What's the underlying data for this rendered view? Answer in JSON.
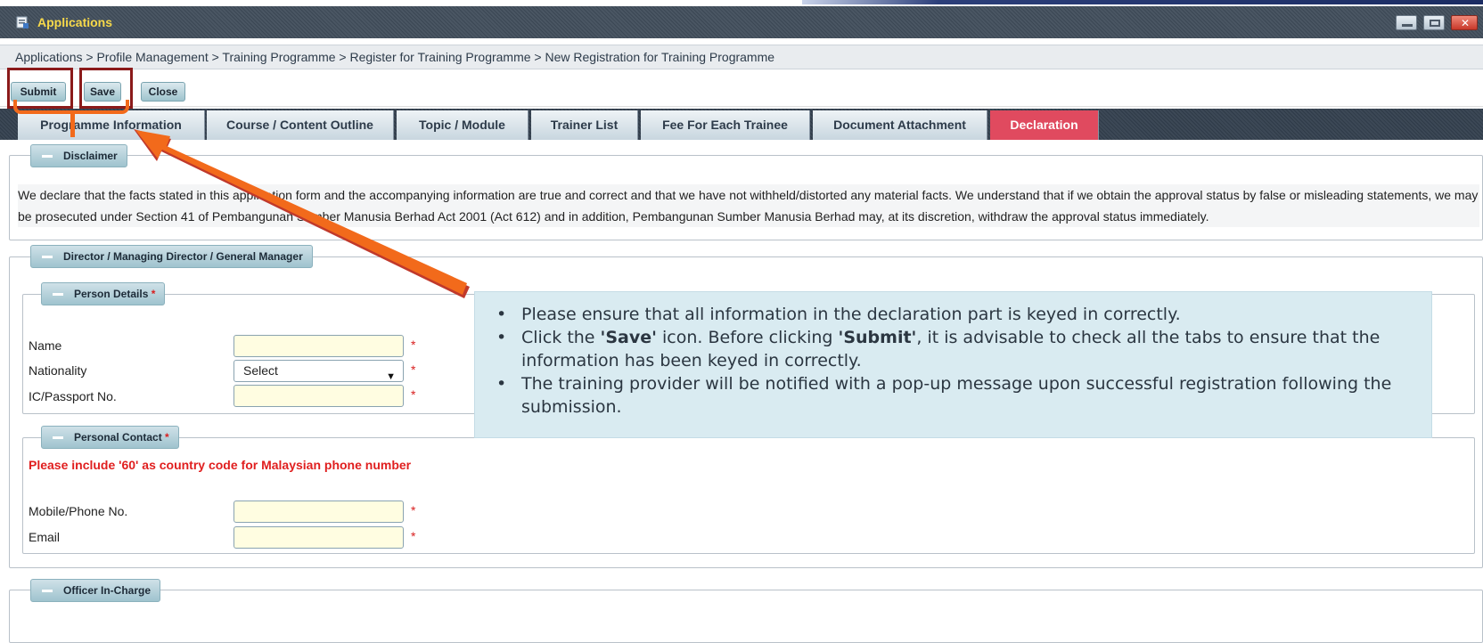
{
  "window": {
    "title": "Applications"
  },
  "breadcrumb": "Applications  >  Profile Management  >  Training Programme  >  Register for Training Programme  >  New Registration for Training Programme",
  "toolbar": {
    "submit": "Submit",
    "save": "Save",
    "close": "Close"
  },
  "tabs": [
    {
      "label": "Programme Information"
    },
    {
      "label": "Course / Content Outline"
    },
    {
      "label": "Topic / Module"
    },
    {
      "label": "Trainer List"
    },
    {
      "label": "Fee For Each Trainee"
    },
    {
      "label": "Document Attachment"
    },
    {
      "label": "Declaration",
      "active": true
    }
  ],
  "disclaimer": {
    "legend": "Disclaimer",
    "text": "We declare that the facts stated in this application form and the accompanying information are true and correct and that we have not withheld/distorted any material facts. We understand that if we obtain the approval status by false or misleading statements, we may be prosecuted under Section 41 of Pembangunan Sumber Manusia Berhad Act 2001 (Act 612) and in addition, Pembangunan Sumber Manusia Berhad may, at its discretion, withdraw the approval status immediately."
  },
  "director": {
    "legend": "Director / Managing Director / General Manager",
    "person_details": {
      "legend": "Person Details",
      "name_label": "Name",
      "name_value": "",
      "nationality_label": "Nationality",
      "nationality_value": "Select",
      "ic_label": "IC/Passport No.",
      "ic_value": ""
    },
    "personal_contact": {
      "legend": "Personal Contact",
      "note": "Please include '60' as country code for Malaysian phone number",
      "mobile_label": "Mobile/Phone No.",
      "mobile_value": "",
      "email_label": "Email",
      "email_value": ""
    }
  },
  "officer": {
    "legend": "Officer In-Charge"
  },
  "callout": {
    "items": [
      "Please ensure that all information in the declaration part is keyed in correctly.",
      "Click the 'Save' icon. Before clicking 'Submit', it is advisable to check all the tabs to ensure that the information has been keyed in correctly.",
      "The training provider will be notified with a pop-up message upon successful registration following the submission."
    ],
    "item2_parts": [
      "Click the ",
      "'Save'",
      " icon. Before clicking ",
      "'Submit'",
      ", it is advisable to check all the tabs to ensure that the information has been keyed in correctly."
    ]
  },
  "required_mark": "*",
  "colors": {
    "active_tab": "#e04a5f",
    "arrow": "#f26a1b",
    "highlight_box": "#8b1a1a",
    "title_text": "#f7d94a"
  },
  "icons": [
    "app-icon",
    "minimize-icon",
    "maximize-icon",
    "close-window-icon",
    "collapse-icon",
    "chevron-down-icon",
    "pointer-arrow-icon"
  ]
}
